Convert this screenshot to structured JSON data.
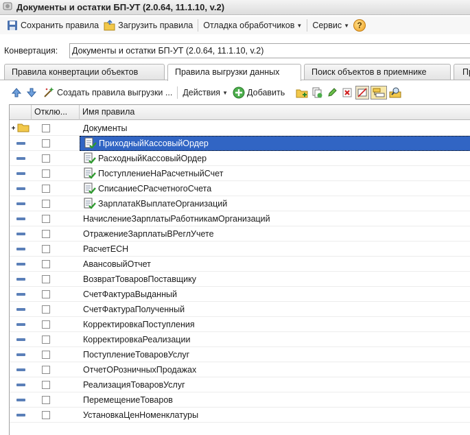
{
  "window": {
    "title": "Документы и остатки БП-УТ (2.0.64, 11.1.10, v.2)"
  },
  "toolbar": {
    "save_rules": "Сохранить правила",
    "load_rules": "Загрузить правила",
    "debug_handlers": "Отладка обработчиков",
    "service": "Сервис",
    "help": "?"
  },
  "conversion": {
    "label": "Конвертация:",
    "value": "Документы и остатки БП-УТ (2.0.64, 11.1.10, v.2)"
  },
  "tabs": [
    {
      "label": "Правила конвертации объектов"
    },
    {
      "label": "Правила выгрузки данных"
    },
    {
      "label": "Поиск объектов в приемнике"
    },
    {
      "label": "Пр"
    }
  ],
  "rules_toolbar": {
    "create_rules": "Создать правила выгрузки ...",
    "actions": "Действия",
    "add": "Добавить"
  },
  "grid": {
    "columns": {
      "disabled": "Отклю...",
      "rule_name": "Имя правила"
    },
    "group": {
      "name": "Документы",
      "expander": "+"
    },
    "rows": [
      {
        "name": "ПриходныйКассовыйОрдер",
        "has_doc_icon": true,
        "selected": true
      },
      {
        "name": "РасходныйКассовыйОрдер",
        "has_doc_icon": true,
        "selected": false
      },
      {
        "name": "ПоступлениеНаРасчетныйСчет",
        "has_doc_icon": true,
        "selected": false
      },
      {
        "name": "СписаниеСРасчетногоСчета",
        "has_doc_icon": true,
        "selected": false
      },
      {
        "name": "ЗарплатаКВыплатеОрганизаций",
        "has_doc_icon": true,
        "selected": false
      },
      {
        "name": "НачислениеЗарплатыРаботникамОрганизаций",
        "has_doc_icon": false,
        "selected": false
      },
      {
        "name": "ОтражениеЗарплатыВРеглУчете",
        "has_doc_icon": false,
        "selected": false
      },
      {
        "name": "РасчетЕСН",
        "has_doc_icon": false,
        "selected": false
      },
      {
        "name": "АвансовыйОтчет",
        "has_doc_icon": false,
        "selected": false
      },
      {
        "name": "ВозвратТоваровПоставщику",
        "has_doc_icon": false,
        "selected": false
      },
      {
        "name": "СчетФактураВыданный",
        "has_doc_icon": false,
        "selected": false
      },
      {
        "name": "СчетФактураПолученный",
        "has_doc_icon": false,
        "selected": false
      },
      {
        "name": "КорректировкаПоступления",
        "has_doc_icon": false,
        "selected": false
      },
      {
        "name": "КорректировкаРеализации",
        "has_doc_icon": false,
        "selected": false
      },
      {
        "name": "ПоступлениеТоваровУслуг",
        "has_doc_icon": false,
        "selected": false
      },
      {
        "name": "ОтчетОРозничныхПродажах",
        "has_doc_icon": false,
        "selected": false
      },
      {
        "name": "РеализацияТоваровУслуг",
        "has_doc_icon": false,
        "selected": false
      },
      {
        "name": "ПеремещениеТоваров",
        "has_doc_icon": false,
        "selected": false
      },
      {
        "name": "УстановкаЦенНоменклатуры",
        "has_doc_icon": false,
        "selected": false
      }
    ]
  },
  "colors": {
    "selection": "#3165c4",
    "accent_blue": "#5a7fb8"
  }
}
